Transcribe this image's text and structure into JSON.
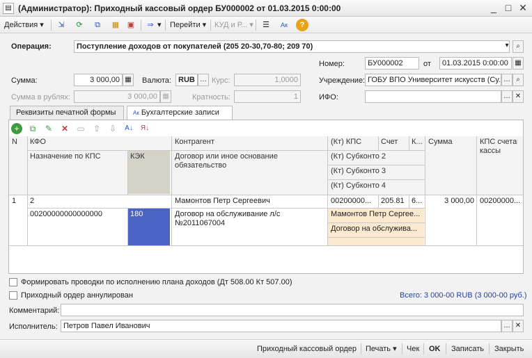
{
  "window": {
    "title": "(Администратор): Приходный кассовый ордер БУ000002 от 01.03.2015 0:00:00",
    "controls": [
      "_",
      "□",
      "✕"
    ]
  },
  "toolbar": {
    "actions_label": "Действия",
    "go_label": "Перейти",
    "kud_label": "КУД и Р..."
  },
  "header": {
    "operation_label": "Операция:",
    "operation_value": "Поступление доходов от покупателей (205 20-30,70-80; 209 70)",
    "number_label": "Номер:",
    "number_value": "БУ000002",
    "date_label": "от",
    "date_value": "01.03.2015  0:00:00",
    "sum_label": "Сумма:",
    "sum_value": "3 000,00",
    "currency_label": "Валюта:",
    "currency_value": "RUB",
    "rate_label": "Курс:",
    "rate_value": "1,0000",
    "institution_label": "Учреждение:",
    "institution_value": "ГОБУ ВПО Университет искусств (Су...",
    "sum_rub_label": "Сумма в рублях:",
    "sum_rub_value": "3 000,00",
    "multiplicity_label": "Кратность:",
    "multiplicity_value": "1",
    "ifo_label": "ИФО:",
    "ifo_value": ""
  },
  "tabs": [
    {
      "label": "Реквизиты печатной формы"
    },
    {
      "label": "Бухгалтерские записи"
    }
  ],
  "grid": {
    "headers": {
      "n": "N",
      "kfo": "КФО",
      "purpose": "Назначение по КПС",
      "kek": "КЭК",
      "counterparty": "Контрагент",
      "contract": "Договор или иное основание обязательство",
      "kt_kps": "(Кт) КПС",
      "account": "Счет",
      "k": "К...",
      "sub2": "(Кт) Субконто 2",
      "sub3": "(Кт) Субконто 3",
      "sub4": "(Кт) Субконто 4",
      "amount": "Сумма",
      "kps_cash": "КПС счета кассы"
    },
    "row": {
      "n": "1",
      "kfo": "2",
      "purpose": "00200000000000000",
      "kek": "180",
      "counterparty": "Мамонтов Петр Сергеевич",
      "contract": "Договор на обслуживание л/с №2011067004",
      "kt_kps": "00200000...",
      "account": "205.81",
      "k": "6...",
      "sub2": "Мамонтов Петр Сергее...",
      "sub3": "Договор на обслужива...",
      "amount": "3 000,00",
      "kps_cash": "00200000..."
    }
  },
  "options": {
    "form_entries_label": "Формировать проводки по исполнению плана доходов (Дт 508.00 Кт 507.00)",
    "annulled_label": "Приходный ордер аннулирован",
    "total_text": "Всего: 3 000-00 RUB (3 000-00 руб.)"
  },
  "footer_fields": {
    "comment_label": "Комментарий:",
    "comment_value": "",
    "executor_label": "Исполнитель:",
    "executor_value": "Петров Павел Иванович"
  },
  "bottom": {
    "print_form_label": "Приходный кассовый ордер",
    "print_label": "Печать",
    "check_label": "Чек",
    "ok_label": "OK",
    "save_label": "Записать",
    "close_label": "Закрыть"
  },
  "colors": {
    "kek_highlight": "#4a63c4",
    "subconto_bg": "#fbe9cf",
    "total_text": "#1f3fae"
  }
}
